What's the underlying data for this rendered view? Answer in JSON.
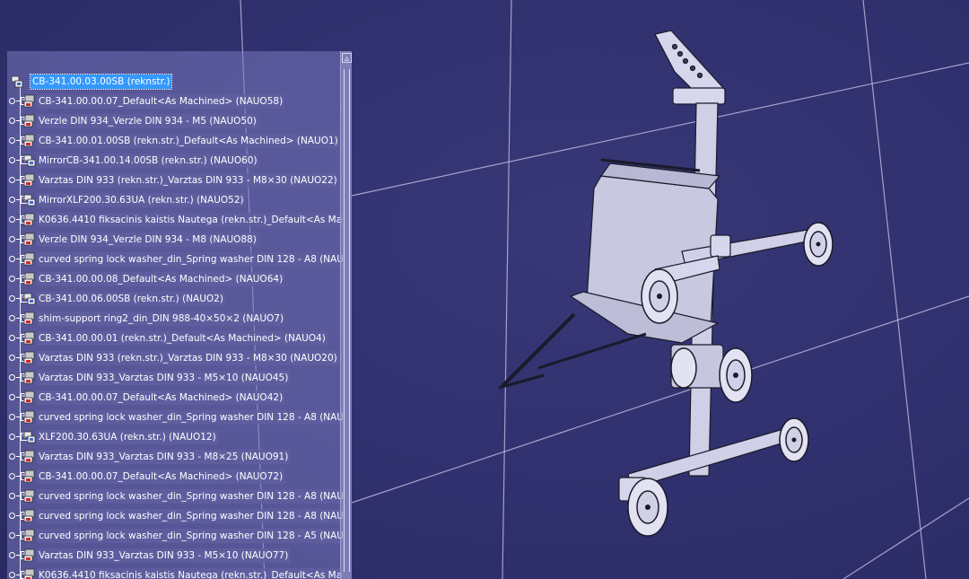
{
  "tree": {
    "root": {
      "label": "CB-341.00.03.00SB (reknstr.)",
      "icon": "assembly-icon"
    },
    "items": [
      {
        "label": "CB-341.00.00.07_Default<As Machined> (NAUO58)",
        "icon": "part-icon"
      },
      {
        "label": "Verzle DIN 934_Verzle DIN 934 - M5 (NAUO50)",
        "icon": "part-icon"
      },
      {
        "label": "CB-341.00.01.00SB (rekn.str.)_Default<As Machined> (NAUO1)",
        "icon": "part-icon"
      },
      {
        "label": "MirrorCB-341.00.14.00SB (rekn.str.) (NAUO60)",
        "icon": "assembly-icon"
      },
      {
        "label": "Varztas DIN 933 (rekn.str.)_Varztas DIN 933 - M8×30 (NAUO22)",
        "icon": "part-icon"
      },
      {
        "label": "MirrorXLF200.30.63UA (rekn.str.) (NAUO52)",
        "icon": "assembly-icon"
      },
      {
        "label": "K0636.4410 fiksacinis kaistis Nautega (rekn.str.)_Default<As Machin",
        "icon": "part-icon"
      },
      {
        "label": "Verzle DIN 934_Verzle DIN 934 - M8 (NAUO88)",
        "icon": "part-icon"
      },
      {
        "label": "curved spring lock washer_din_Spring washer DIN 128 - A8 (NAUO",
        "icon": "part-icon"
      },
      {
        "label": "CB-341.00.00.08_Default<As Machined> (NAUO64)",
        "icon": "part-icon"
      },
      {
        "label": "CB-341.00.06.00SB (rekn.str.) (NAUO2)",
        "icon": "assembly-icon"
      },
      {
        "label": "shim-support ring2_din_DIN 988-40×50×2 (NAUO7)",
        "icon": "part-icon"
      },
      {
        "label": "CB-341.00.00.01 (rekn.str.)_Default<As Machined> (NAUO4)",
        "icon": "part-icon"
      },
      {
        "label": "Varztas DIN 933 (rekn.str.)_Varztas DIN 933 - M8×30 (NAUO20)",
        "icon": "part-icon"
      },
      {
        "label": "Varztas DIN 933_Varztas DIN 933 - M5×10 (NAUO45)",
        "icon": "part-icon"
      },
      {
        "label": "CB-341.00.00.07_Default<As Machined> (NAUO42)",
        "icon": "part-icon"
      },
      {
        "label": "curved spring lock washer_din_Spring washer DIN 128 - A8 (NAUO",
        "icon": "part-icon"
      },
      {
        "label": "XLF200.30.63UA (rekn.str.) (NAUO12)",
        "icon": "assembly-icon"
      },
      {
        "label": "Varztas DIN 933_Varztas DIN 933 - M8×25 (NAUO91)",
        "icon": "part-icon"
      },
      {
        "label": "CB-341.00.00.07_Default<As Machined> (NAUO72)",
        "icon": "part-icon"
      },
      {
        "label": "curved spring lock washer_din_Spring washer DIN 128 - A8 (NAUO",
        "icon": "part-icon"
      },
      {
        "label": "curved spring lock washer_din_Spring washer DIN 128 - A8 (NAUO",
        "icon": "part-icon"
      },
      {
        "label": "curved spring lock washer_din_Spring washer DIN 128 - A5 (NAUO",
        "icon": "part-icon"
      },
      {
        "label": "Varztas DIN 933_Varztas DIN 933 - M5×10 (NAUO77)",
        "icon": "part-icon"
      },
      {
        "label": "K0636.4410 fiksacinis kaistis Nautega (rekn.str.)_Default<As Machin",
        "icon": "part-icon"
      }
    ]
  },
  "scrollbar": {
    "up_arrow": "▵"
  },
  "colors": {
    "background": "#2f2f6b",
    "selection": "#3399ff",
    "part_icon_body": "#c9c9c9",
    "part_icon_accent": "#d22a2a"
  }
}
